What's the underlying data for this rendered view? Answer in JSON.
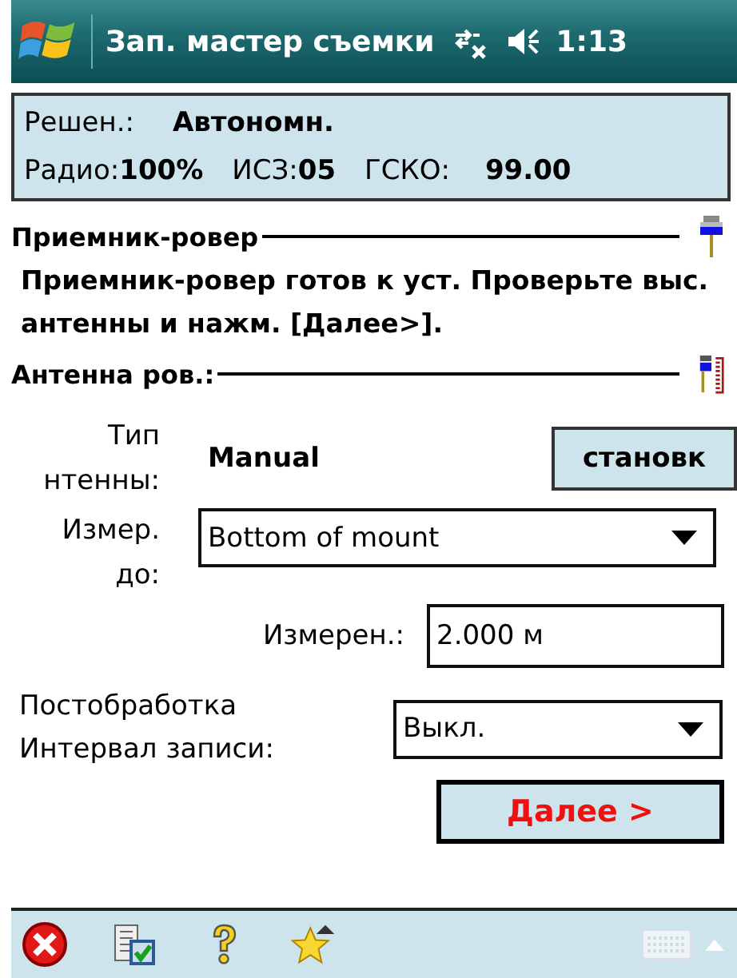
{
  "title_bar": {
    "title": "Зап. мастер съемки",
    "clock": "1:13"
  },
  "status": {
    "solution_label": "Решен.:",
    "solution_value": "Автономн.",
    "radio_label": "Радио:",
    "radio_value": "100%",
    "sats_label": "ИСЗ:",
    "sats_value": "05",
    "pdop_label": "ГСКО:",
    "pdop_value": "99.00"
  },
  "receiver_section": {
    "heading": "Приемник-ровер",
    "message": "Приемник-ровер готов к уст. Проверьте выс. антенны и нажм. [Далее>]."
  },
  "antenna_section": {
    "heading": "Антенна ров.:"
  },
  "form": {
    "antenna_type_label": "Тип\nнтенны:",
    "antenna_type_value": "Manual",
    "setup_button": "становк",
    "measured_to_label": "Измер.\nдо:",
    "measured_to_value": "Bottom of mount",
    "measured_label": "Измерен.:",
    "measured_value": "2.000 м",
    "logging_label": "Постобработка\nИнтервал записи:",
    "logging_value": "Выкл."
  },
  "next_button": "Далее >"
}
